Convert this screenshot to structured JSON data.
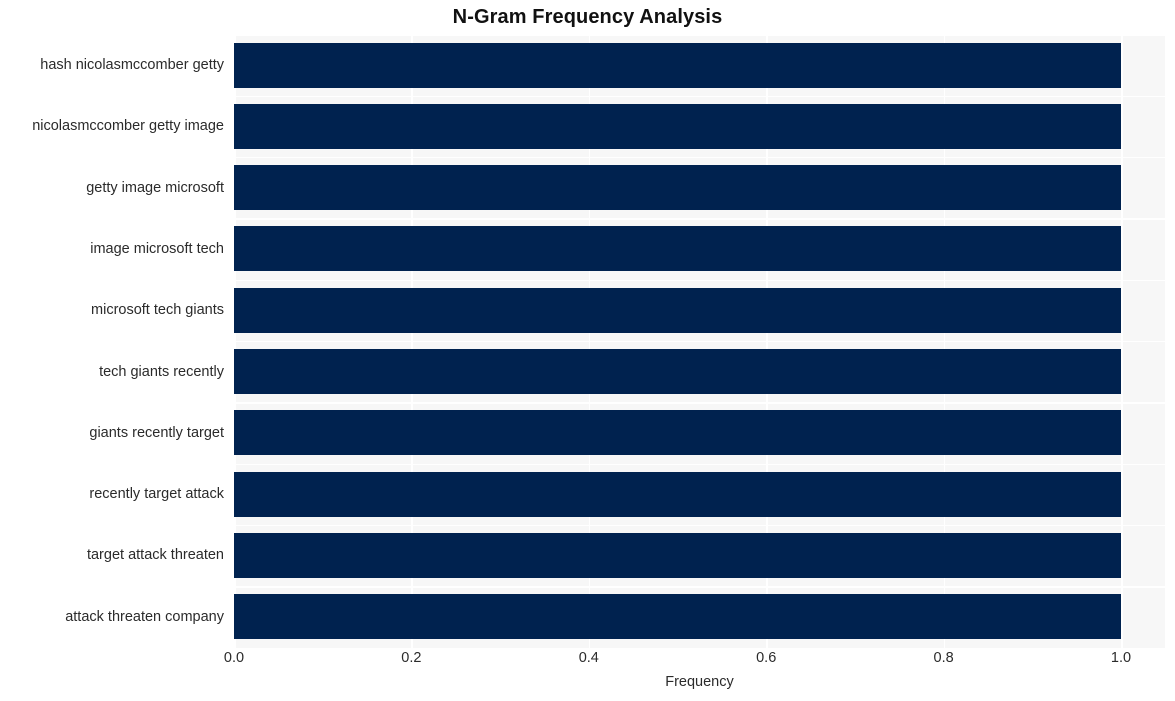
{
  "chart_data": {
    "type": "bar",
    "orientation": "horizontal",
    "title": "N-Gram Frequency Analysis",
    "xlabel": "Frequency",
    "ylabel": "",
    "categories": [
      "hash nicolasmccomber getty",
      "nicolasmccomber getty image",
      "getty image microsoft",
      "image microsoft tech",
      "microsoft tech giants",
      "tech giants recently",
      "giants recently target",
      "recently target attack",
      "target attack threaten",
      "attack threaten company"
    ],
    "values": [
      1.0,
      1.0,
      1.0,
      1.0,
      1.0,
      1.0,
      1.0,
      1.0,
      1.0,
      1.0
    ],
    "xlim": [
      0.0,
      1.0
    ],
    "xticks": [
      "0.0",
      "0.2",
      "0.4",
      "0.6",
      "0.8",
      "1.0"
    ],
    "xtick_values": [
      0.0,
      0.2,
      0.4,
      0.6,
      0.8,
      1.0
    ],
    "grid": true,
    "legend": false,
    "bar_color": "#00224f",
    "plot_background": "#f7f7f7",
    "figure_background": "#ffffff",
    "gridline_color": "#ffffff",
    "text_color": "#2b2b2b",
    "title_color": "#111111"
  }
}
